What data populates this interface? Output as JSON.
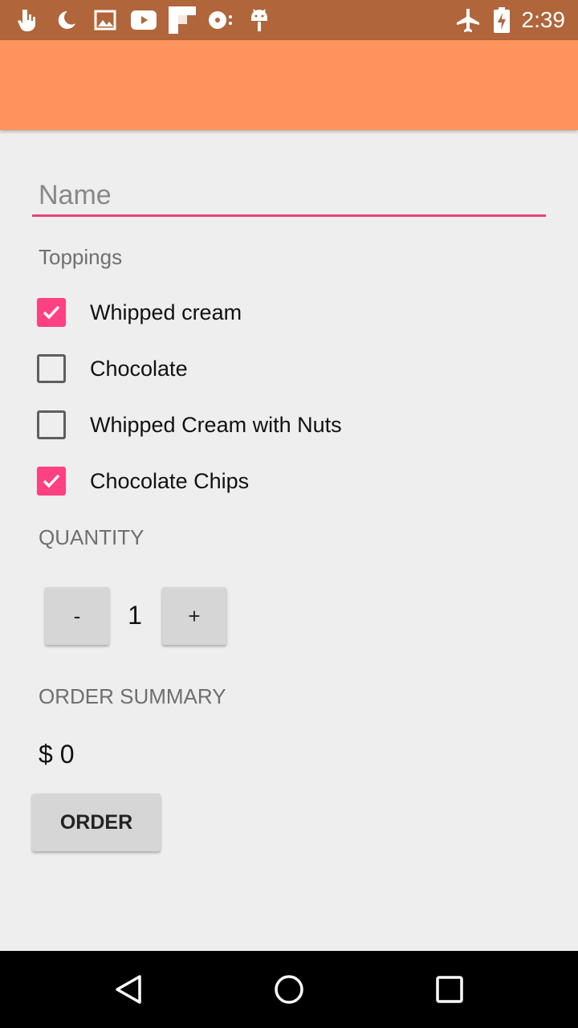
{
  "status_bar": {
    "time": "2:39",
    "notification_icons": [
      "touch-hand-icon",
      "moon-icon",
      "image-icon",
      "youtube-icon",
      "flipboard-icon",
      "disc-icon",
      "android-icon"
    ],
    "system_icons": [
      "airplane-mode-icon",
      "battery-charging-icon"
    ]
  },
  "form": {
    "name_placeholder": "Name",
    "name_value": "",
    "toppings_label": "Toppings",
    "toppings": [
      {
        "label": "Whipped cream",
        "checked": true
      },
      {
        "label": "Chocolate",
        "checked": false
      },
      {
        "label": "Whipped Cream with Nuts",
        "checked": false
      },
      {
        "label": "Chocolate Chips",
        "checked": true
      }
    ],
    "quantity_label": "QUANTITY",
    "decrement_label": "-",
    "quantity_value": "1",
    "increment_label": "+",
    "order_summary_label": "ORDER SUMMARY",
    "price_text": "$ 0",
    "order_button_label": "ORDER"
  },
  "nav_bar": {
    "icons": [
      "back-icon",
      "home-icon",
      "recents-icon"
    ]
  },
  "colors": {
    "status_bar": "#b0653b",
    "app_bar": "#ff935d",
    "accent": "#ff4081",
    "background": "#eeeeee"
  }
}
